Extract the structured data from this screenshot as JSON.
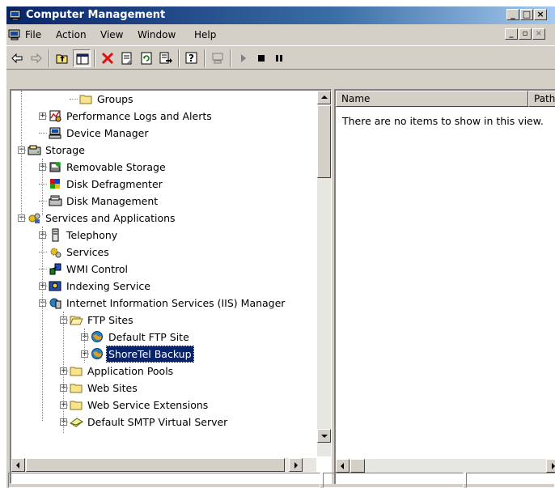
{
  "window": {
    "title": "Computer Management",
    "app_icon": "computer-management-icon"
  },
  "menu": {
    "items": [
      {
        "label": "File"
      },
      {
        "label": "Action"
      },
      {
        "label": "View"
      },
      {
        "label": "Window"
      },
      {
        "label": "Help"
      }
    ]
  },
  "toolbar": {
    "buttons": [
      "back-arrow-icon",
      "forward-arrow-icon",
      "up-folder-icon",
      "show-hide-tree-icon",
      "delete-icon",
      "properties-icon",
      "refresh-icon",
      "export-list-icon",
      "help-icon",
      "console-icon",
      "play-icon",
      "stop-icon",
      "pause-icon"
    ]
  },
  "tree": {
    "items": [
      {
        "label": "Groups",
        "icon": "folder-icon"
      },
      {
        "label": "Performance Logs and Alerts",
        "icon": "performance-logs-icon",
        "expandable": true
      },
      {
        "label": "Device Manager",
        "icon": "device-manager-icon"
      },
      {
        "label": "Storage",
        "icon": "storage-icon",
        "expanded": true
      },
      {
        "label": "Removable Storage",
        "icon": "removable-storage-icon",
        "expandable": true
      },
      {
        "label": "Disk Defragmenter",
        "icon": "disk-defragmenter-icon"
      },
      {
        "label": "Disk Management",
        "icon": "disk-management-icon"
      },
      {
        "label": "Services and Applications",
        "icon": "services-apps-icon",
        "expanded": true
      },
      {
        "label": "Telephony",
        "icon": "telephony-icon",
        "expandable": true
      },
      {
        "label": "Services",
        "icon": "services-gear-icon"
      },
      {
        "label": "WMI Control",
        "icon": "wmi-control-icon"
      },
      {
        "label": "Indexing Service",
        "icon": "indexing-service-icon",
        "expandable": true
      },
      {
        "label": "Internet Information Services (IIS) Manager",
        "icon": "iis-manager-icon",
        "expanded": true
      },
      {
        "label": "FTP Sites",
        "icon": "folder-open-icon",
        "expanded": true
      },
      {
        "label": "Default FTP Site",
        "icon": "ftp-site-globe-icon",
        "expandable": true
      },
      {
        "label": "ShoreTel Backup",
        "icon": "ftp-site-globe-icon",
        "expandable": true,
        "selected": true
      },
      {
        "label": "Application Pools",
        "icon": "folder-icon",
        "expandable": true
      },
      {
        "label": "Web Sites",
        "icon": "folder-icon",
        "expandable": true
      },
      {
        "label": "Web Service Extensions",
        "icon": "folder-icon",
        "expandable": true
      },
      {
        "label": "Default SMTP Virtual Server",
        "icon": "smtp-server-icon",
        "expandable": true
      }
    ]
  },
  "list": {
    "columns": [
      {
        "label": "Name"
      },
      {
        "label": "Path"
      }
    ],
    "empty_message": "There are no items to show in this view."
  },
  "colors": {
    "title_gradient_start": "#0a246a",
    "selection_bg": "#0a246a",
    "chrome": "#d4d0c8"
  }
}
